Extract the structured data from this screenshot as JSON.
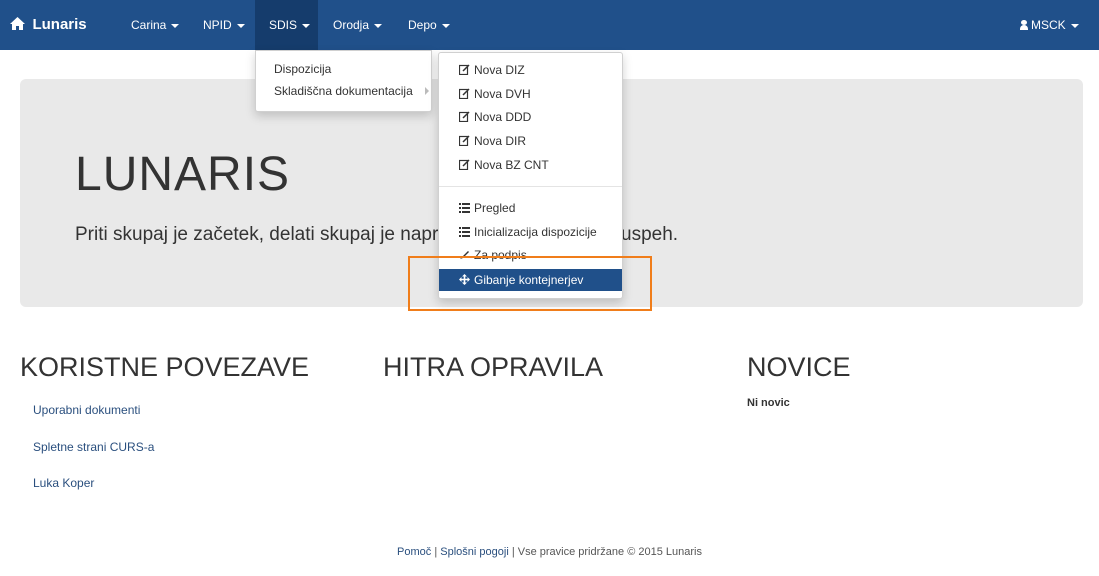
{
  "navbar": {
    "brand": "Lunaris",
    "items": [
      {
        "label": "Carina"
      },
      {
        "label": "NPID"
      },
      {
        "label": "SDIS"
      },
      {
        "label": "Orodja"
      },
      {
        "label": "Depo"
      }
    ],
    "user": "MSCK"
  },
  "sdis_menu": {
    "items": [
      {
        "label": "Dispozicija"
      },
      {
        "label": "Skladiščna dokumentacija"
      }
    ]
  },
  "submenu": {
    "create_items": [
      {
        "label": "Nova DIZ"
      },
      {
        "label": "Nova DVH"
      },
      {
        "label": "Nova DDD"
      },
      {
        "label": "Nova DIR"
      },
      {
        "label": "Nova BZ CNT"
      }
    ],
    "other_items": [
      {
        "label": "Pregled"
      },
      {
        "label": "Inicializacija dispozicije"
      },
      {
        "label": "Za podpis"
      },
      {
        "label": "Gibanje kontejnerjev"
      }
    ],
    "active_item": "Gibanje kontejnerjev"
  },
  "jumbotron": {
    "title": "LUNARIS",
    "subtitle": "Priti skupaj je začetek, delati skupaj je napredek, ostati skupaj je uspeh."
  },
  "sections": {
    "links_title": "KORISTNE POVEZAVE",
    "links": [
      {
        "label": "Uporabni dokumenti"
      },
      {
        "label": "Spletne strani CURS-a"
      },
      {
        "label": "Luka Koper"
      }
    ],
    "tasks_title": "HITRA OPRAVILA",
    "news_title": "NOVICE",
    "news_empty": "Ni novic"
  },
  "footer": {
    "help": "Pomoč",
    "terms": "Splošni pogoji",
    "separator": "|",
    "copyright": "Vse pravice pridržane © 2015 Lunaris"
  },
  "colors": {
    "navbar": "#20508a",
    "active_item": "#20508a",
    "highlight": "#f07d1a"
  }
}
